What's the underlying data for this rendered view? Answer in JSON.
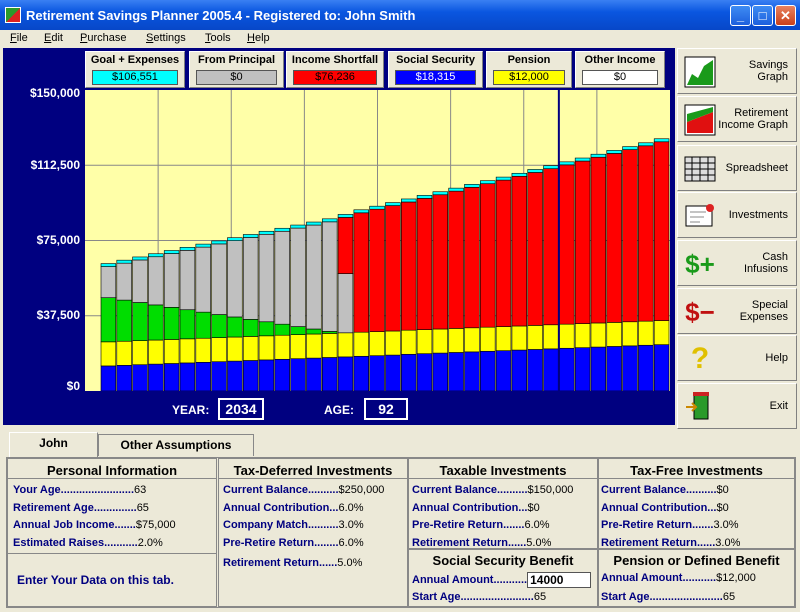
{
  "window": {
    "title": "Retirement Savings Planner 2005.4 - Registered to: John  Smith"
  },
  "menu": [
    "File",
    "Edit",
    "Purchase",
    "Settings",
    "Tools",
    "Help"
  ],
  "info_boxes": [
    {
      "label": "Goal + Expenses",
      "value": "$106,551",
      "color": "#00ffff"
    },
    {
      "label": "From Principal",
      "value": "$0",
      "color": "#c0c0c0"
    },
    {
      "label": "Income Shortfall",
      "value": "$76,236",
      "color": "#ff0000"
    },
    {
      "label": "Social Security",
      "value": "$18,315",
      "color": "#0000ff"
    },
    {
      "label": "Pension",
      "value": "$12,000",
      "color": "#ffff00"
    },
    {
      "label": "Other Income",
      "value": "$0",
      "color": "#ffffff"
    }
  ],
  "chart_data": {
    "type": "bar",
    "stacked": true,
    "ylim": [
      0,
      150000
    ],
    "yticks": [
      "$150,000",
      "$112,500",
      "$75,000",
      "$37,500",
      "$0"
    ],
    "grid": true,
    "highlight_year": 2034,
    "series": [
      {
        "color": "#0000ff",
        "values": [
          12500,
          12800,
          13100,
          13400,
          13700,
          14000,
          14300,
          14600,
          14900,
          15200,
          15500,
          15800,
          16100,
          16400,
          16700,
          17000,
          17300,
          17600,
          17900,
          18300,
          18600,
          18900,
          19200,
          19500,
          19800,
          20100,
          20400,
          20700,
          21000,
          21300,
          21600,
          21900,
          22200,
          22500,
          22800,
          23100
        ]
      },
      {
        "color": "#ffff00",
        "values": [
          12000,
          12000,
          12000,
          12000,
          12000,
          12000,
          12000,
          12000,
          12000,
          12000,
          12000,
          12000,
          12000,
          12000,
          12000,
          12000,
          12000,
          12000,
          12000,
          12000,
          12000,
          12000,
          12000,
          12000,
          12000,
          12000,
          12000,
          12000,
          12000,
          12000,
          12000,
          12000,
          12000,
          12000,
          12000,
          12000
        ]
      },
      {
        "color": "#00dd00",
        "values": [
          22000,
          20500,
          19000,
          17500,
          16000,
          14500,
          13000,
          11500,
          10000,
          8500,
          7000,
          5500,
          4000,
          2500,
          1000,
          0,
          0,
          0,
          0,
          0,
          0,
          0,
          0,
          0,
          0,
          0,
          0,
          0,
          0,
          0,
          0,
          0,
          0,
          0,
          0,
          0
        ]
      },
      {
        "color": "#c0c0c0",
        "values": [
          15500,
          18400,
          21200,
          24000,
          26800,
          29600,
          32400,
          35200,
          38000,
          40800,
          43600,
          46300,
          49100,
          51800,
          54600,
          29500,
          0,
          0,
          0,
          0,
          0,
          0,
          0,
          0,
          0,
          0,
          0,
          0,
          0,
          0,
          0,
          0,
          0,
          0,
          0,
          0
        ]
      },
      {
        "color": "#ff0000",
        "values": [
          0,
          0,
          0,
          0,
          0,
          0,
          0,
          0,
          0,
          0,
          0,
          0,
          0,
          0,
          0,
          28000,
          59500,
          61000,
          62500,
          63900,
          65400,
          66900,
          68400,
          70000,
          71500,
          73000,
          74600,
          76200,
          77800,
          79400,
          81000,
          82600,
          84200,
          85800,
          87400,
          89100
        ]
      },
      {
        "color": "#00ffff",
        "values": [
          1500,
          1500,
          1500,
          1500,
          1500,
          1500,
          1500,
          1500,
          1500,
          1500,
          1500,
          1500,
          1500,
          1500,
          1500,
          1500,
          1500,
          1500,
          1500,
          1500,
          1500,
          1500,
          1500,
          1500,
          1500,
          1500,
          1500,
          1500,
          1500,
          1500,
          1500,
          1500,
          1500,
          1500,
          1500,
          1500
        ]
      }
    ]
  },
  "year_label": "YEAR:",
  "year_value": "2034",
  "age_label": "AGE:",
  "age_value": "92",
  "side_buttons": [
    {
      "label": "Savings Graph",
      "icon": "savings-graph-icon"
    },
    {
      "label": "Retirement Income Graph",
      "icon": "income-graph-icon"
    },
    {
      "label": "Spreadsheet",
      "icon": "spreadsheet-icon"
    },
    {
      "label": "Investments",
      "icon": "investments-icon"
    },
    {
      "label": "Cash Infusions",
      "icon": "dollar-plus-icon"
    },
    {
      "label": "Special Expenses",
      "icon": "dollar-minus-icon"
    },
    {
      "label": "Help",
      "icon": "question-icon"
    },
    {
      "label": "Exit",
      "icon": "exit-door-icon"
    }
  ],
  "tabs": [
    "John",
    "Other Assumptions"
  ],
  "personal": {
    "title": "Personal Information",
    "rows": [
      {
        "k": "Your Age........................",
        "v": "63"
      },
      {
        "k": "Retirement Age..............",
        "v": "65"
      },
      {
        "k": "Annual Job Income.......",
        "v": "$75,000"
      },
      {
        "k": "Estimated Raises...........",
        "v": "2.0%"
      }
    ],
    "hint": "Enter Your Data on this tab."
  },
  "taxdef": {
    "title": "Tax-Deferred Investments",
    "rows": [
      {
        "k": "Current Balance..........",
        "v": "$250,000"
      },
      {
        "k": "Annual Contribution...",
        "v": "6.0%"
      },
      {
        "k": "Company Match..........",
        "v": "3.0%"
      },
      {
        "k": "Pre-Retire Return........",
        "v": "6.0%"
      },
      {
        "k": "Retirement Return......",
        "v": "5.0%"
      }
    ]
  },
  "taxable": {
    "title": "Taxable Investments",
    "rows": [
      {
        "k": "Current Balance..........",
        "v": "$150,000"
      },
      {
        "k": "Annual Contribution...",
        "v": "$0"
      },
      {
        "k": "Pre-Retire Return.......",
        "v": "6.0%"
      },
      {
        "k": "Retirement Return......",
        "v": "5.0%"
      }
    ]
  },
  "taxfree": {
    "title": "Tax-Free Investments",
    "rows": [
      {
        "k": "Current Balance..........",
        "v": "$0"
      },
      {
        "k": "Annual Contribution...",
        "v": "$0"
      },
      {
        "k": "Pre-Retire Return.......",
        "v": "3.0%"
      },
      {
        "k": "Retirement Return......",
        "v": "3.0%"
      }
    ]
  },
  "ssb": {
    "title": "Social Security Benefit",
    "amount_label": "Annual Amount...........",
    "amount_value": "14000",
    "start_label": "Start Age........................",
    "start_value": "65"
  },
  "pension": {
    "title": "Pension or Defined Benefit",
    "amount_label": "Annual Amount...........",
    "amount_value": "$12,000",
    "start_label": "Start Age........................",
    "start_value": "65"
  }
}
